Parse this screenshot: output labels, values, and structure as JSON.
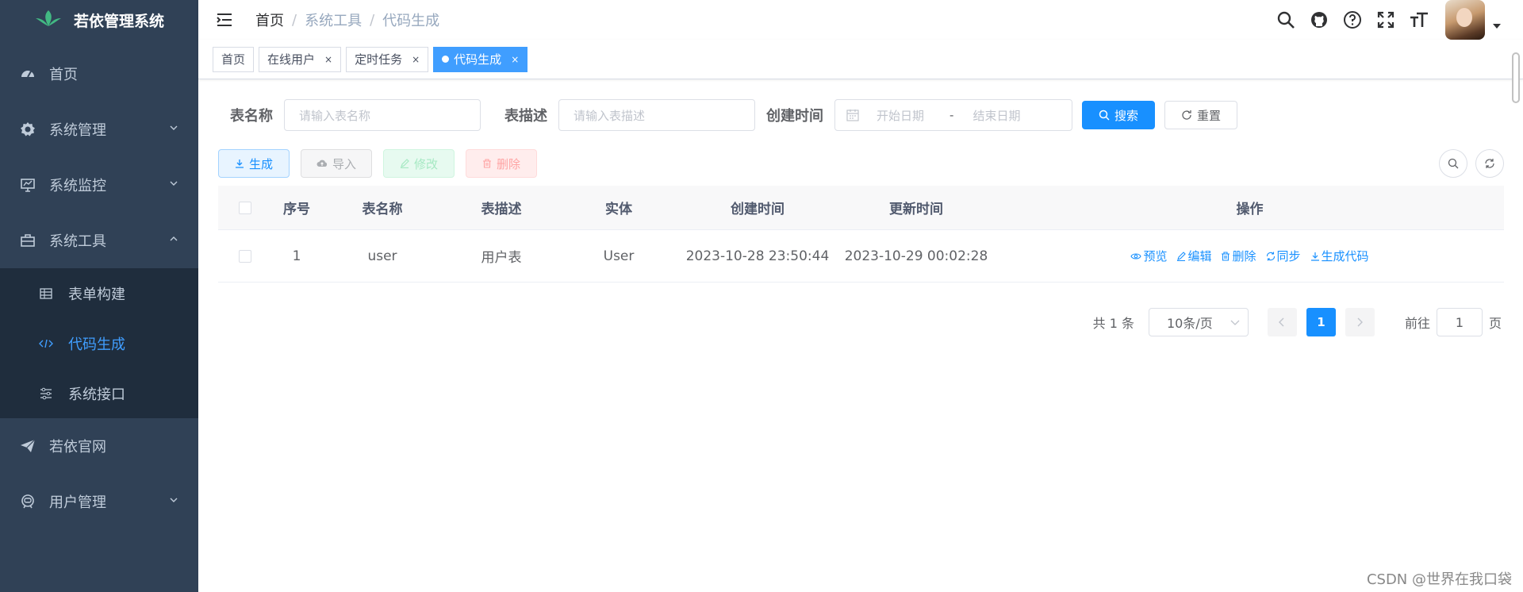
{
  "app": {
    "title": "若依管理系统"
  },
  "sidebar": {
    "items": [
      {
        "label": "首页",
        "icon": "dashboard-icon"
      },
      {
        "label": "系统管理",
        "icon": "gear-icon"
      },
      {
        "label": "系统监控",
        "icon": "monitor-icon"
      },
      {
        "label": "系统工具",
        "icon": "toolbox-icon"
      },
      {
        "label": "若依官网",
        "icon": "paper-plane-icon"
      },
      {
        "label": "用户管理",
        "icon": "user-icon"
      }
    ],
    "tools_children": [
      {
        "label": "表单构建",
        "icon": "form-icon"
      },
      {
        "label": "代码生成",
        "icon": "code-icon",
        "active": true
      },
      {
        "label": "系统接口",
        "icon": "sliders-icon"
      }
    ]
  },
  "breadcrumb": {
    "root": "首页",
    "level1": "系统工具",
    "level2": "代码生成"
  },
  "tags": [
    {
      "label": "首页"
    },
    {
      "label": "在线用户",
      "close": "×"
    },
    {
      "label": "定时任务",
      "close": "×"
    },
    {
      "label": "代码生成",
      "close": "×",
      "active": true
    }
  ],
  "search": {
    "table_name_label": "表名称",
    "table_name_placeholder": "请输入表名称",
    "table_desc_label": "表描述",
    "table_desc_placeholder": "请输入表描述",
    "create_time_label": "创建时间",
    "start_placeholder": "开始日期",
    "range_separator": "-",
    "end_placeholder": "结束日期",
    "search_button": "搜索",
    "reset_button": "重置"
  },
  "toolbar": {
    "generate": "生成",
    "import": "导入",
    "edit": "修改",
    "delete": "删除"
  },
  "table": {
    "headers": {
      "index": "序号",
      "name": "表名称",
      "desc": "表描述",
      "entity": "实体",
      "created": "创建时间",
      "updated": "更新时间",
      "actions": "操作"
    },
    "rows": [
      {
        "index": "1",
        "name": "user",
        "desc": "用户表",
        "entity": "User",
        "created": "2023-10-28 23:50:44",
        "updated": "2023-10-29 00:02:28"
      }
    ],
    "actions": {
      "preview": "预览",
      "edit": "编辑",
      "delete": "删除",
      "sync": "同步",
      "gen": "生成代码"
    }
  },
  "pagination": {
    "total_text": "共 1 条",
    "page_size": "10条/页",
    "current": "1",
    "goto_label": "前往",
    "goto_value": "1",
    "page_suffix": "页"
  },
  "watermark": "CSDN @世界在我口袋",
  "colors": {
    "sidebar_bg": "#304156",
    "submenu_bg": "#1f2d3d",
    "primary": "#1890ff",
    "active_text": "#409eff"
  }
}
